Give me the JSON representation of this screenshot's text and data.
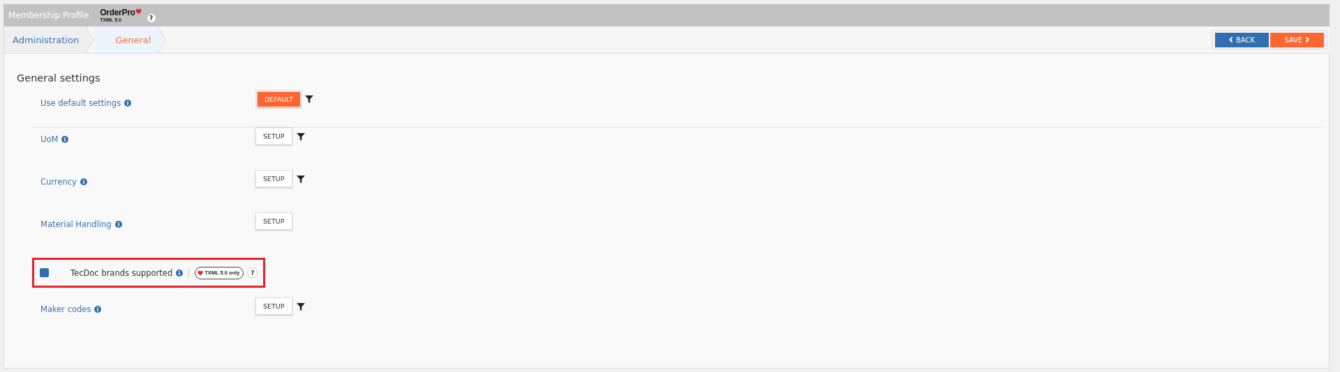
{
  "header": {
    "title": "Membership Profile",
    "logo_name": "OrderPro",
    "logo_version": "TXML 5.0",
    "help": "?"
  },
  "breadcrumbs": [
    {
      "label": "Administration",
      "selected": false
    },
    {
      "label": "General",
      "selected": true
    }
  ],
  "actions": [
    {
      "label": "BACK",
      "kind": "back"
    },
    {
      "label": "SAVE",
      "kind": "save"
    }
  ],
  "section": {
    "title": "General settings",
    "rows": [
      {
        "kind": "default",
        "label": "Use default settings",
        "button": "DEFAULT",
        "filter": true
      },
      {
        "kind": "setup",
        "label": "UoM",
        "button": "SETUP",
        "filter": true
      },
      {
        "kind": "setup",
        "label": "Currency",
        "button": "SETUP",
        "filter": true
      },
      {
        "kind": "setup",
        "label": "Material Handling",
        "button": "SETUP",
        "filter": false
      },
      {
        "kind": "checkbox",
        "label": "TecDoc brands supported",
        "checked": true,
        "highlighted": true,
        "badge": "TXML 5.0 only",
        "help": "?"
      },
      {
        "kind": "setup",
        "label": "Maker codes",
        "button": "SETUP",
        "filter": true
      }
    ]
  }
}
